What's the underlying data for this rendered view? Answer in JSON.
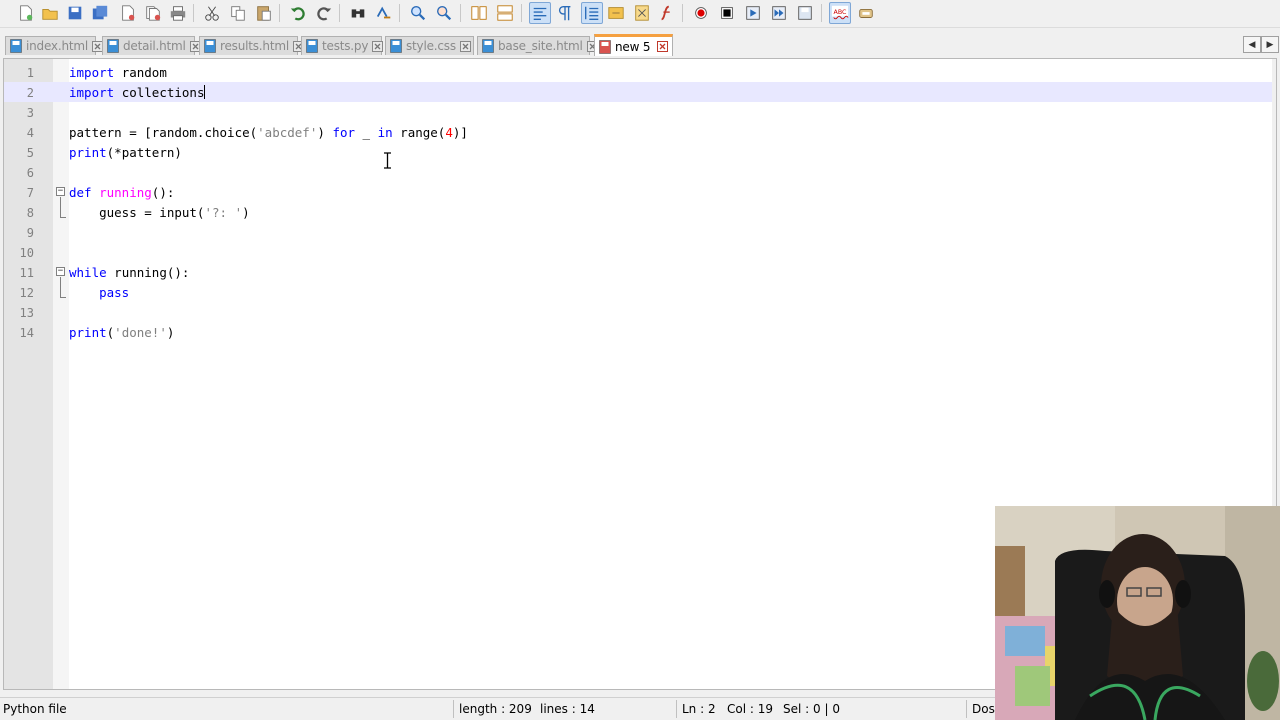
{
  "app": {
    "name": "Notepad++"
  },
  "toolbar": {
    "buttons": [
      {
        "name": "new-file-icon",
        "active": false
      },
      {
        "name": "open-file-icon",
        "active": false
      },
      {
        "name": "save-icon",
        "active": false
      },
      {
        "name": "save-all-icon",
        "active": false
      },
      {
        "name": "close-icon",
        "active": false
      },
      {
        "name": "close-all-icon",
        "active": false
      },
      {
        "name": "print-icon",
        "active": false
      },
      {
        "name": "cut-icon",
        "active": false
      },
      {
        "name": "copy-icon",
        "active": false
      },
      {
        "name": "paste-icon",
        "active": false
      },
      {
        "name": "undo-icon",
        "active": false
      },
      {
        "name": "redo-icon",
        "active": false
      },
      {
        "name": "find-icon",
        "active": false
      },
      {
        "name": "replace-icon",
        "active": false
      },
      {
        "name": "zoom-in-icon",
        "active": false
      },
      {
        "name": "zoom-out-icon",
        "active": false
      },
      {
        "name": "sync-vertical-icon",
        "active": false
      },
      {
        "name": "sync-horizontal-icon",
        "active": false
      },
      {
        "name": "word-wrap-icon",
        "active": true
      },
      {
        "name": "show-all-chars-icon",
        "active": false
      },
      {
        "name": "indent-guide-icon",
        "active": true
      },
      {
        "name": "user-language-icon",
        "active": false
      },
      {
        "name": "document-map-icon",
        "active": false
      },
      {
        "name": "function-list-icon",
        "active": false
      },
      {
        "name": "record-macro-icon",
        "active": false
      },
      {
        "name": "stop-macro-icon",
        "active": false
      },
      {
        "name": "play-macro-icon",
        "active": false
      },
      {
        "name": "run-macro-multiple-icon",
        "active": false
      },
      {
        "name": "save-macro-icon",
        "active": false
      },
      {
        "name": "spellcheck-icon",
        "active": true
      },
      {
        "name": "plugin-icon",
        "active": false
      }
    ]
  },
  "tabs": [
    {
      "label": "index.html",
      "active": false,
      "modified": false
    },
    {
      "label": "detail.html",
      "active": false,
      "modified": false
    },
    {
      "label": "results.html",
      "active": false,
      "modified": false
    },
    {
      "label": "tests.py",
      "active": false,
      "modified": false
    },
    {
      "label": "style.css",
      "active": false,
      "modified": false
    },
    {
      "label": "base_site.html",
      "active": false,
      "modified": false
    },
    {
      "label": "new 5",
      "active": true,
      "modified": true
    }
  ],
  "tab_nav": {
    "left": "◀",
    "right": "▶"
  },
  "editor": {
    "current_line": 2,
    "lines": [
      {
        "n": "1",
        "tokens": [
          [
            "kw",
            "import"
          ],
          [
            "",
            "random"
          ]
        ]
      },
      {
        "n": "2",
        "tokens": [
          [
            "kw",
            "import"
          ],
          [
            "",
            "collections"
          ]
        ]
      },
      {
        "n": "3",
        "tokens": []
      },
      {
        "n": "4",
        "tokens": [
          [
            "",
            "pattern = [random.choice("
          ],
          [
            "str",
            "'abcdef'"
          ],
          [
            "",
            ") "
          ],
          [
            "kw",
            "for"
          ],
          [
            "",
            " _ "
          ],
          [
            "kw",
            "in"
          ],
          [
            "",
            " range("
          ],
          [
            "num",
            "4"
          ],
          [
            "",
            ")]"
          ]
        ]
      },
      {
        "n": "5",
        "tokens": [
          [
            "kw",
            "print"
          ],
          [
            "",
            "(*pattern)"
          ]
        ]
      },
      {
        "n": "6",
        "tokens": []
      },
      {
        "n": "7",
        "tokens": [
          [
            "kw",
            "def"
          ],
          [
            "",
            " "
          ],
          [
            "fn",
            "running"
          ],
          [
            "",
            "():"
          ]
        ]
      },
      {
        "n": "8",
        "tokens": [
          [
            "",
            "    guess = input("
          ],
          [
            "str",
            "'?: '"
          ],
          [
            "",
            ")"
          ]
        ]
      },
      {
        "n": "9",
        "tokens": []
      },
      {
        "n": "10",
        "tokens": []
      },
      {
        "n": "11",
        "tokens": [
          [
            "kw",
            "while"
          ],
          [
            "",
            " running():"
          ]
        ]
      },
      {
        "n": "12",
        "tokens": [
          [
            "",
            "    "
          ],
          [
            "kw",
            "pass"
          ]
        ]
      },
      {
        "n": "13",
        "tokens": []
      },
      {
        "n": "14",
        "tokens": [
          [
            "kw",
            "print"
          ],
          [
            "",
            "("
          ],
          [
            "str",
            "'done!'"
          ],
          [
            "",
            ")"
          ]
        ]
      }
    ]
  },
  "statusbar": {
    "file_type": "Python file",
    "length": "length : 209",
    "lines": "lines : 14",
    "ln": "Ln : 2",
    "col": "Col : 19",
    "sel": "Sel : 0 | 0",
    "eol": "Dos"
  },
  "colors": {
    "keyword": "#0000ff",
    "function": "#ff00ff",
    "string": "#808080",
    "number": "#ff0000",
    "current_line": "#e8e8ff",
    "active_tab_accent": "#f5a040"
  }
}
